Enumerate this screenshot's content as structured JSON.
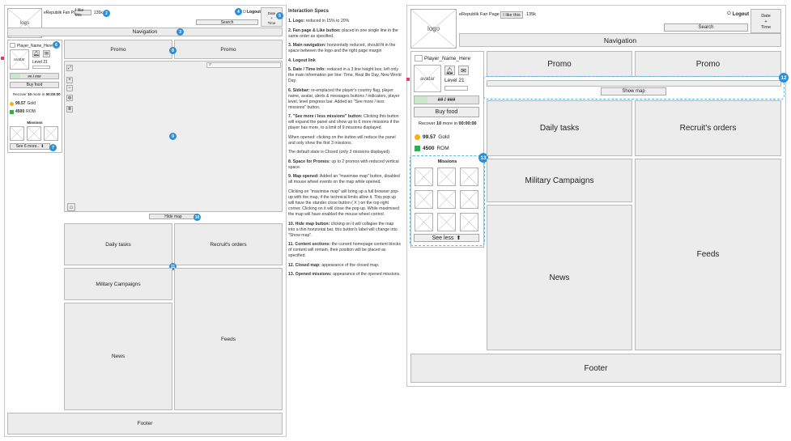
{
  "colors": {
    "badge": "#2c8fd6",
    "dashed_highlight": "#5eb7e8",
    "marker": "#e8357d",
    "gold": "#f2b01e",
    "rom": "#3aa757",
    "panel": "#ececec"
  },
  "left_mockup": {
    "logo": "logo",
    "fan_page": "eRepublik Fan Page",
    "like_button": "I like this",
    "like_count": "135k",
    "logout_icon": "power-icon",
    "logout": "Logout",
    "date_time": [
      "Date",
      "+",
      "Time"
    ],
    "search_button": "Search",
    "navigation": "Navigation",
    "player_name": "Player_Name_Here",
    "avatar": "avatar",
    "level": "Level 21",
    "xp": "## / ###",
    "buy_food": "Buy food",
    "recover_pre": "Recover",
    "recover_num": "10",
    "recover_mid": "more in",
    "recover_time": "00:00:00",
    "gold_value": "99.57",
    "gold_label": "Gold",
    "rom_value": "4500",
    "rom_label": "ROM",
    "missions_title": "Missions",
    "see_more": "See 6 more..",
    "promo_1": "Promo",
    "promo_2": "Promo",
    "hide_map": "Hide map",
    "daily_tasks": "Daily tasks",
    "recruits_orders": "Recruit's orders",
    "military_campaigns": "Military Campaigns",
    "news": "News",
    "feeds": "Feeds",
    "footer": "Footer",
    "badges": [
      "1",
      "2",
      "3",
      "4",
      "5",
      "6",
      "7",
      "8",
      "9",
      "10",
      "11"
    ]
  },
  "specs": {
    "title": "Interaction Specs",
    "items": [
      {
        "head": "1. Logo:",
        "text": " reduced in 15% to 20%"
      },
      {
        "head": "2. Fan page & Like button:",
        "text": " placed in one single line in the same order as specified."
      },
      {
        "head": "3. Main navigation:",
        "text": " horizontally reduced, should fit in the space between the logo and the right page margin"
      },
      {
        "head": "4. Logout link",
        "text": ""
      },
      {
        "head": "5. Date / Time info:",
        "text": " reduced in a 3 line height box, left only the main information per line: Time, Real life Day, New World Day."
      },
      {
        "head": "6. Sidebar:",
        "text": " re-emplaced the player's country flag, player name, avatar, alerts & messages buttons / indicators, player level, level progress bar. Added an \"See more / less missions\" button."
      },
      {
        "head": "7. \"See more / less missions\" button:",
        "text": " Clicking this button will expand the panel and show up to 6 more missions if the player has more, to a limit of 9 missions displayed."
      },
      {
        "head": "",
        "text": "When opened: clicking on the button will reduce the panel and only show the first 3 missions."
      },
      {
        "head": "",
        "text": "The default state is Closed (only 3 missions displayed)."
      },
      {
        "head": "8. Space for Promos:",
        "text": " up to 2 promos with reduced vertical space."
      },
      {
        "head": "9. Map opened:",
        "text": " Added an \"maximise map\" button, disabled all mouse wheel events on the map while opened."
      },
      {
        "head": "",
        "text": "Clicking on \"maximise map\" will bring up a full browser pop-up with the map, if the technical limits allow it. This pop up will have the stander close button ( X ) on the top right corner. Clicking on it will close the pop up. While maximised the map will have enabled the mouse wheel control."
      },
      {
        "head": "10. Hide map button:",
        "text": " clicking on it will collapse the map into a thin horizontal bar, this button's label will change into \"Show map\"."
      },
      {
        "head": "11. Content sections:",
        "text": " the current homepage content blocks of content will remain, their position will be placed as specified."
      },
      {
        "head": "12. Closed map:",
        "text": " appearance of the closed map."
      },
      {
        "head": "13. Opened missions:",
        "text": " appearance of the opened missions."
      }
    ]
  },
  "right_mockup": {
    "logo": "logo",
    "fan_page": "eRepublik Fan Page",
    "like_button": "I like this",
    "like_count": "135k",
    "logout": "Logout",
    "date_time": [
      "Date",
      "+",
      "Time"
    ],
    "search_button": "Search",
    "navigation": "Navigation",
    "player_name": "Player_Name_Here",
    "avatar": "avatar",
    "level": "Level 21",
    "xp": "## / ###",
    "buy_food": "Buy food",
    "recover_pre": "Recover",
    "recover_num": "10",
    "recover_mid": "more in",
    "recover_time": "00:00:00",
    "gold_value": "99.57",
    "gold_label": "Gold",
    "rom_value": "4500",
    "rom_label": "ROM",
    "missions_title": "Missions",
    "see_less": "See less",
    "promo_1": "Promo",
    "promo_2": "Promo",
    "show_map": "Show map",
    "daily_tasks": "Daily tasks",
    "recruits_orders": "Recruit's orders",
    "military_campaigns": "Military Campaigns",
    "news": "News",
    "feeds": "Feeds",
    "footer": "Footer",
    "badges": [
      "12",
      "13"
    ]
  }
}
